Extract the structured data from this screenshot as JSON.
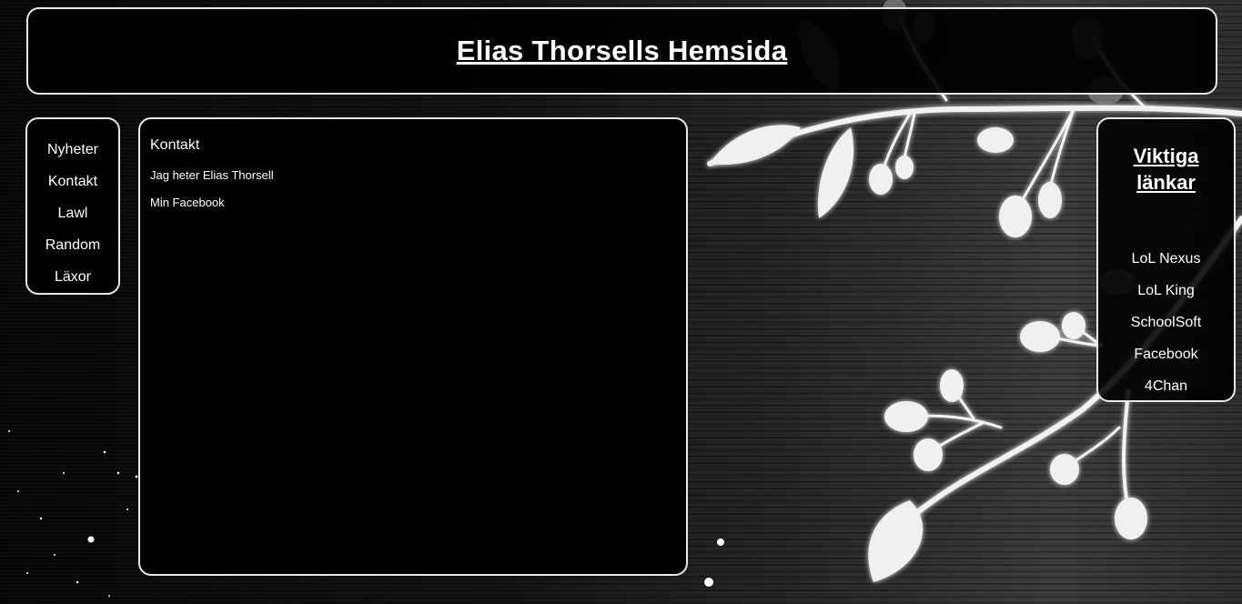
{
  "header": {
    "title": "Elias Thorsells Hemsida"
  },
  "nav": {
    "items": [
      "Nyheter",
      "Kontakt",
      "Lawl",
      "Random",
      "Läxor"
    ]
  },
  "content": {
    "heading": "Kontakt",
    "intro": "Jag heter Elias Thorsell",
    "facebook_link": "Min Facebook"
  },
  "sidebar": {
    "title_line1": "Viktiga",
    "title_line2": "länkar",
    "links": [
      "LoL Nexus",
      "LoL King",
      "SchoolSoft",
      "Facebook",
      "4Chan"
    ]
  }
}
